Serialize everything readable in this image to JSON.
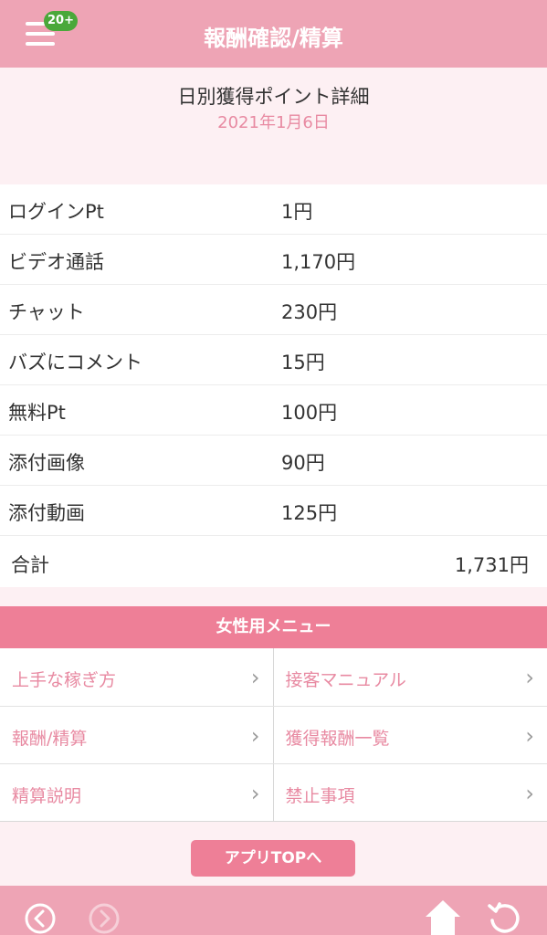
{
  "header": {
    "title": "報酬確認/精算",
    "badge": "20+"
  },
  "detail": {
    "heading": "日別獲得ポイント詳細",
    "date": "2021年1月6日"
  },
  "rows": [
    {
      "label": "ログインPt",
      "value": "1円"
    },
    {
      "label": "ビデオ通話",
      "value": "1,170円"
    },
    {
      "label": "チャット",
      "value": "230円"
    },
    {
      "label": "バズにコメント",
      "value": "15円"
    },
    {
      "label": "無料Pt",
      "value": "100円"
    },
    {
      "label": "添付画像",
      "value": "90円"
    },
    {
      "label": "添付動画",
      "value": "125円"
    }
  ],
  "total": {
    "label": "合計",
    "value": "1,731円"
  },
  "menu": {
    "heading": "女性用メニュー",
    "items": [
      {
        "label": "上手な稼ぎ方"
      },
      {
        "label": "接客マニュアル"
      },
      {
        "label": "報酬/精算"
      },
      {
        "label": "獲得報酬一覧"
      },
      {
        "label": "精算説明"
      },
      {
        "label": "禁止事項"
      }
    ]
  },
  "app_top_button": "アプリTOPへ",
  "icons": {
    "menu": "hamburger-icon",
    "back": "back-icon",
    "forward": "forward-icon",
    "home": "home-icon",
    "reload": "reload-icon",
    "chevron": "chevron-right-icon"
  },
  "colors": {
    "header": "#eea4b5",
    "accent": "#ee7f97",
    "date": "#e88aa2",
    "badge": "#4aa83a"
  }
}
